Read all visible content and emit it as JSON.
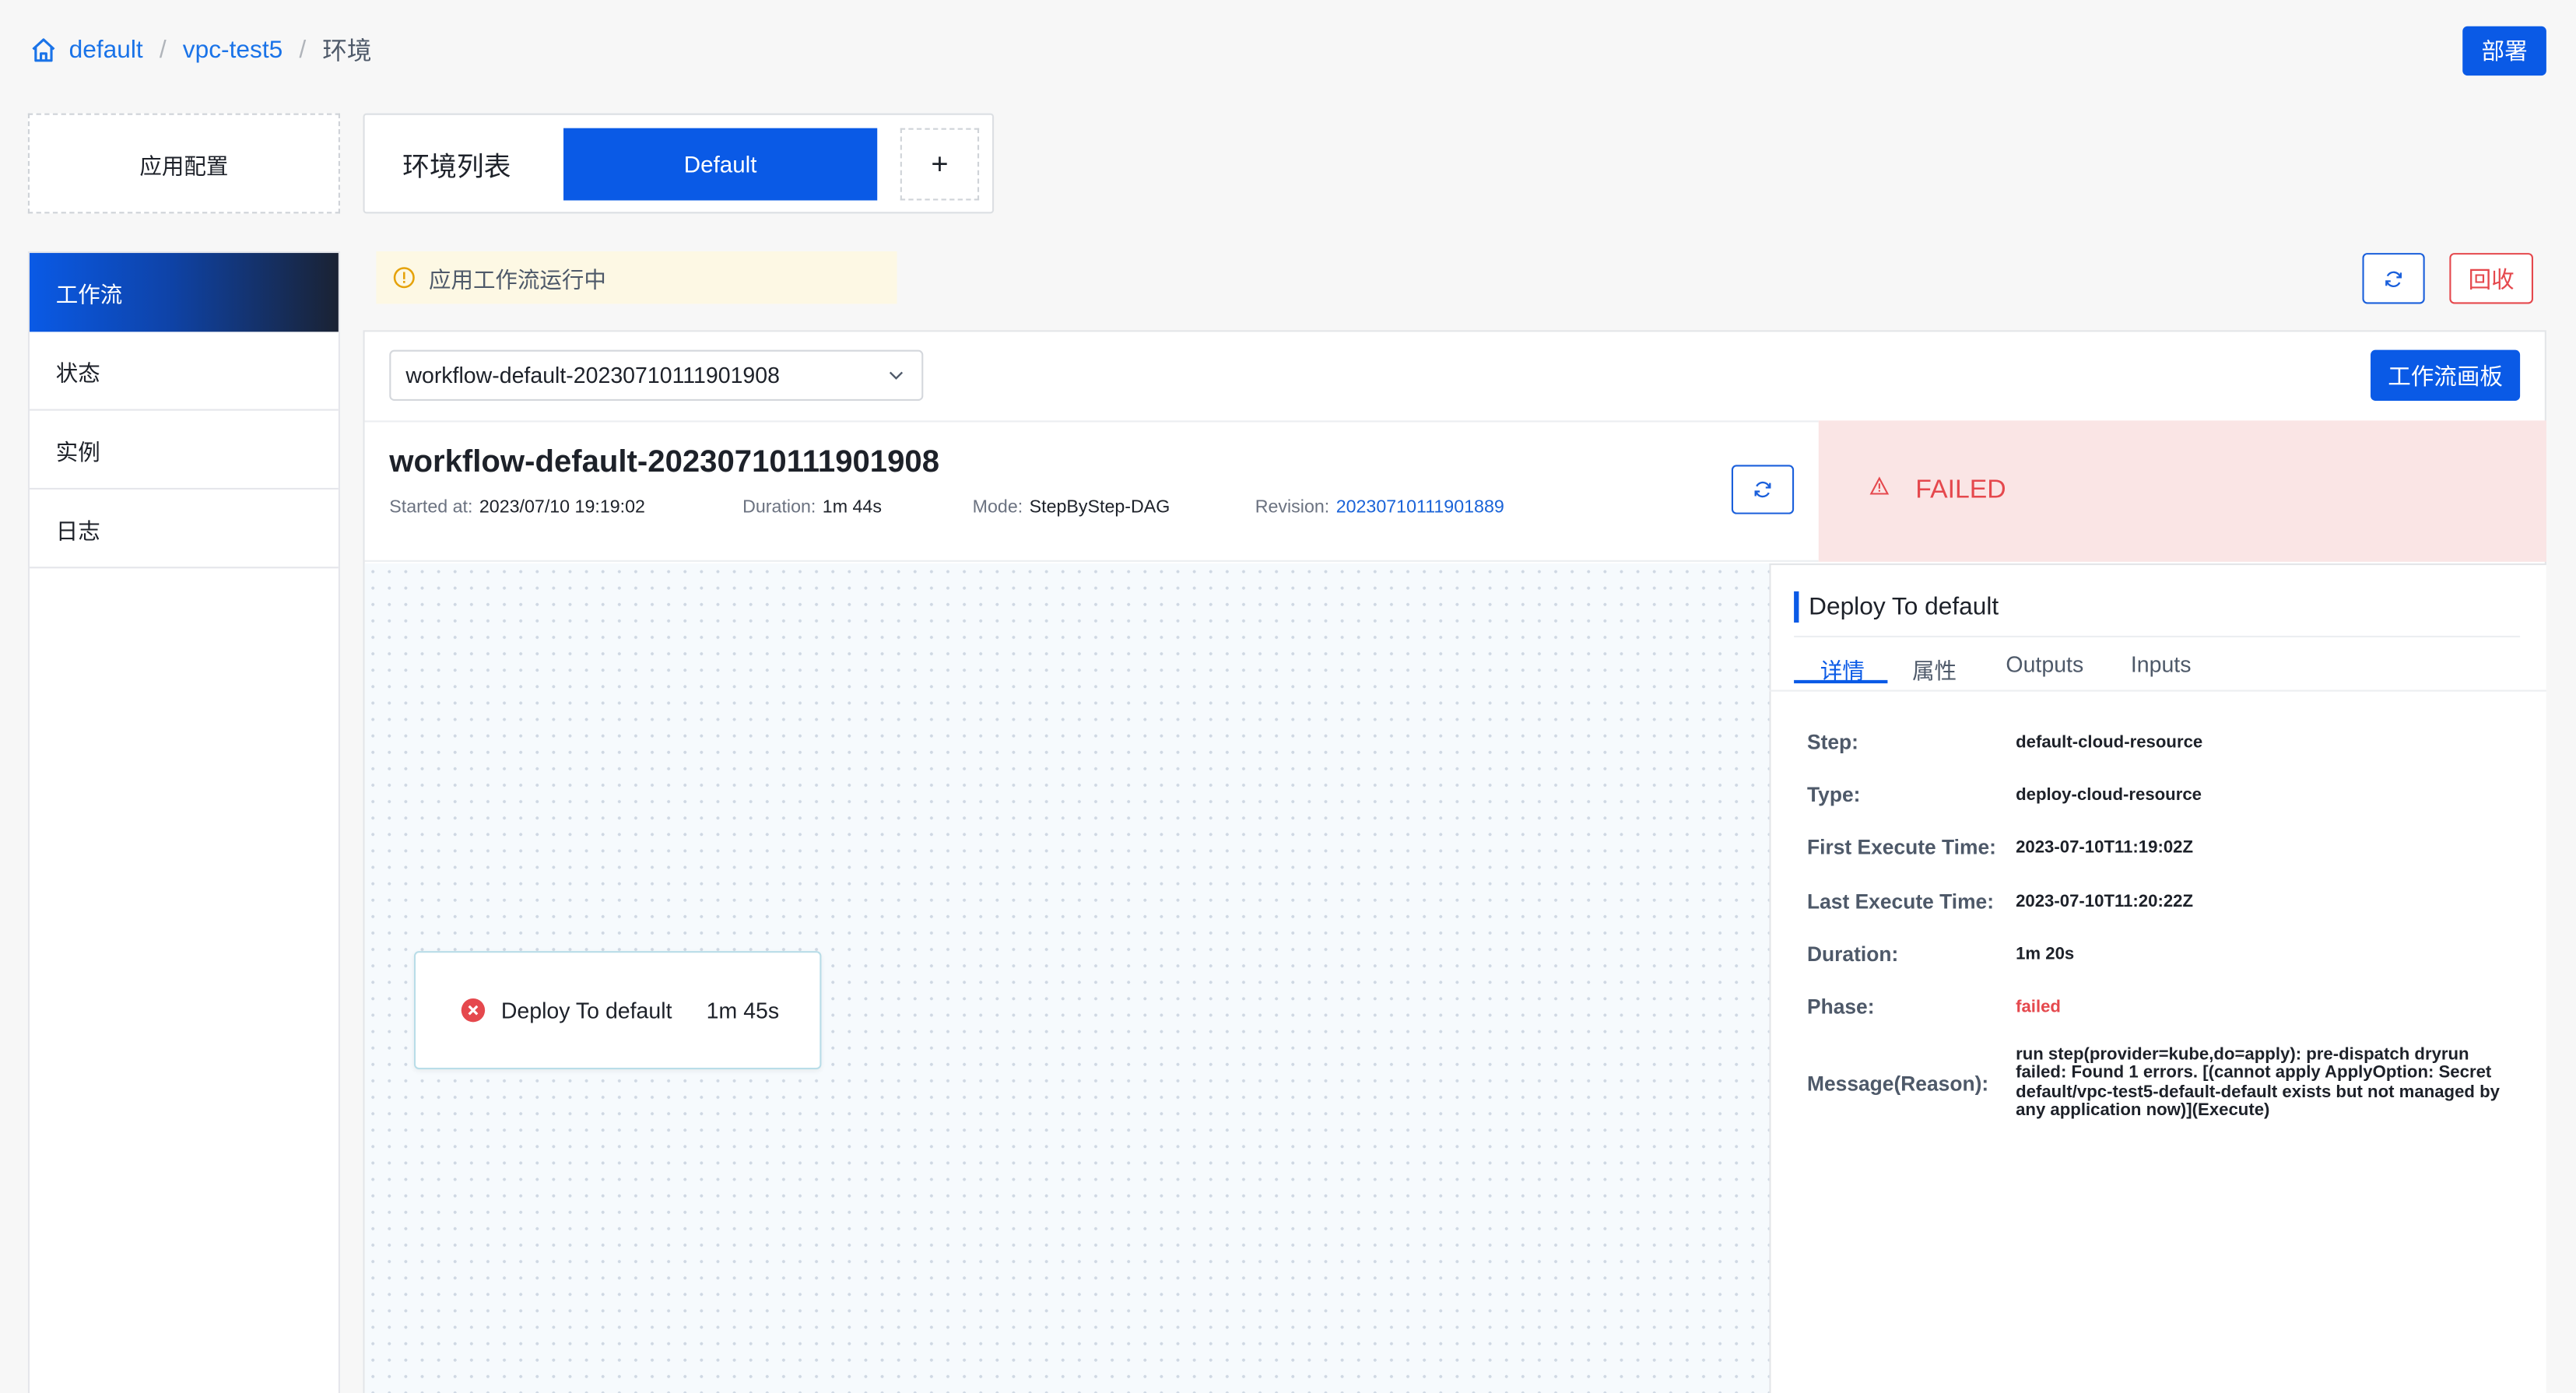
{
  "breadcrumb": {
    "items": [
      "default",
      "vpc-test5"
    ],
    "current": "环境"
  },
  "header": {
    "deploy_label": "部署"
  },
  "app_config_label": "应用配置",
  "env": {
    "list_label": "环境列表",
    "active_tab": "Default",
    "add_label": "+"
  },
  "sidebar": {
    "items": [
      {
        "label": "工作流",
        "active": true
      },
      {
        "label": "状态"
      },
      {
        "label": "实例"
      },
      {
        "label": "日志"
      }
    ]
  },
  "status_banner": "应用工作流运行中",
  "actions": {
    "recycle_label": "回收"
  },
  "workflow": {
    "selected": "workflow-default-20230710111901908",
    "board_label": "工作流画板",
    "title": "workflow-default-20230710111901908",
    "started_label": "Started at:",
    "started_value": "2023/07/10 19:19:02",
    "duration_label": "Duration:",
    "duration_value": "1m 44s",
    "mode_label": "Mode:",
    "mode_value": "StepByStep-DAG",
    "revision_label": "Revision:",
    "revision_value": "20230710111901889",
    "status": "FAILED"
  },
  "node": {
    "name": "Deploy To default",
    "duration": "1m 45s",
    "state": "failed"
  },
  "detail": {
    "title": "Deploy To default",
    "tabs": [
      "详情",
      "属性",
      "Outputs",
      "Inputs"
    ],
    "rows": [
      {
        "label": "Step:",
        "value": "default-cloud-resource"
      },
      {
        "label": "Type:",
        "value": "deploy-cloud-resource"
      },
      {
        "label": "First Execute Time:",
        "value": "2023-07-10T11:19:02Z"
      },
      {
        "label": "Last Execute Time:",
        "value": "2023-07-10T11:20:22Z"
      },
      {
        "label": "Duration:",
        "value": "1m 20s"
      },
      {
        "label": "Phase:",
        "value": "failed"
      }
    ],
    "message_label": "Message(Reason):",
    "message_value": "run step(provider=kube,do=apply): pre-dispatch dryrun failed: Found 1 errors. [(cannot apply ApplyOption: Secret default/vpc-test5-default-default exists but not managed by any application now)](Execute)"
  },
  "colors": {
    "primary": "#0a5ae6",
    "danger": "#e5484d",
    "failed_bg": "#fae5e5",
    "banner_bg": "#fdf8e4"
  }
}
